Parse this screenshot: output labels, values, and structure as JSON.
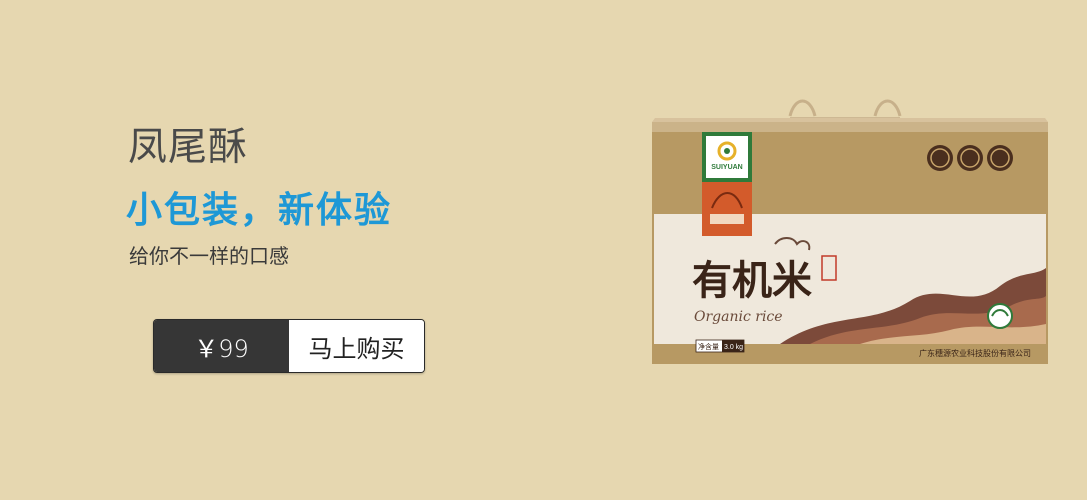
{
  "banner": {
    "title": "凤尾酥",
    "subtitle": "小包装，新体验",
    "tagline": "给你不一样的口感",
    "price": "￥99",
    "buy_label": "马上购买"
  },
  "product": {
    "brand": "SUIYUAN",
    "name": "有机米",
    "english": "Organic rice",
    "weight_label": "净含量",
    "weight_value": "3.0 kg",
    "company": "广东穗源农业科技股份有限公司"
  },
  "colors": {
    "background": "#e6d7b0",
    "accent": "#1e98d6",
    "price_bg": "#363636"
  }
}
